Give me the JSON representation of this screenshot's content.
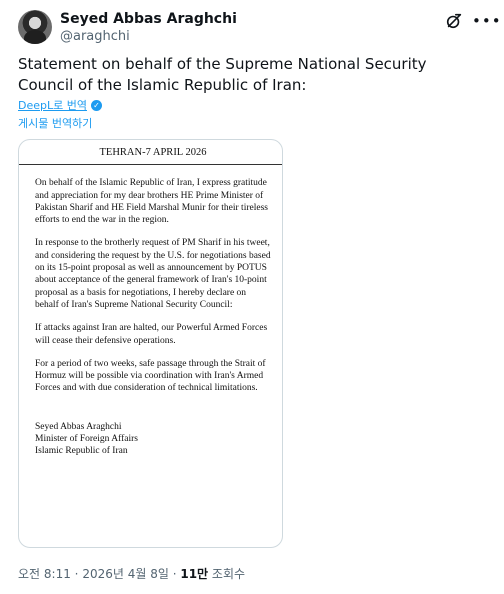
{
  "author": {
    "name": "Seyed Abbas Araghchi",
    "handle": "@araghchi"
  },
  "icons": {
    "grok": "grok-icon",
    "more": "more-icon",
    "deepl_badge": "deepl-badge-icon"
  },
  "tweet": {
    "text": "Statement on behalf of the Supreme National Security Council of the Islamic Republic of Iran:",
    "translate_by": "DeepL로 번역",
    "translate_post": "게시물 번역하기"
  },
  "document": {
    "header": "TEHRAN-7 APRIL 2026",
    "paragraphs": [
      "On behalf of the Islamic Republic of Iran, I express gratitude and appreciation for my dear brothers HE Prime Minister of Pakistan Sharif and HE Field Marshal Munir for their tireless efforts to end the war in the region.",
      "In response to the brotherly request of PM Sharif in his tweet, and considering the request by the U.S. for negotiations based on its 15-point proposal as well as announcement by POTUS about acceptance of the general framework of Iran's 10-point proposal as a basis for negotiations, I hereby declare on behalf of Iran's Supreme National Security Council:",
      "If attacks against Iran are halted, our Powerful Armed Forces will cease their defensive operations.",
      "For a period of two weeks, safe passage through the Strait of Hormuz will be possible via coordination with Iran's Armed Forces and with due consideration of technical limitations."
    ],
    "signature": {
      "name": "Seyed Abbas Araghchi",
      "title": "Minister of Foreign Affairs",
      "country": "Islamic Republic of Iran"
    }
  },
  "meta": {
    "time": "오전 8:11",
    "date": "2026년 4월 8일",
    "views_count": "11만",
    "views_label": "조회수"
  },
  "colors": {
    "text": "#0f1419",
    "secondary": "#536471",
    "link": "#1d9bf0",
    "border": "#cfd9de"
  }
}
